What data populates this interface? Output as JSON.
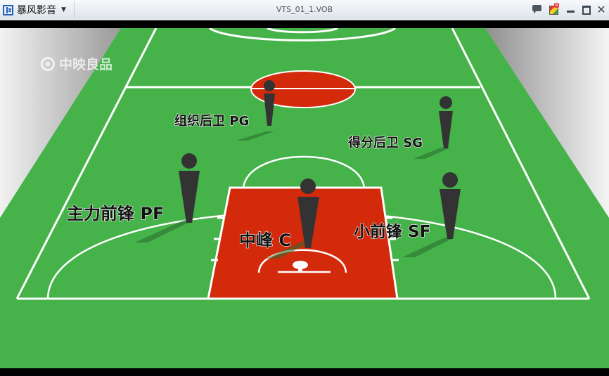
{
  "app": {
    "name": "暴风影音"
  },
  "window": {
    "file_title": "VTS_01_1.VOB"
  },
  "video": {
    "watermark": "中映良品",
    "players": [
      {
        "label": "组织后卫 PG"
      },
      {
        "label": "得分后卫 SG"
      },
      {
        "label": "主力前锋 PF"
      },
      {
        "label": "中峰 C"
      },
      {
        "label": "小前锋 SF"
      }
    ]
  }
}
